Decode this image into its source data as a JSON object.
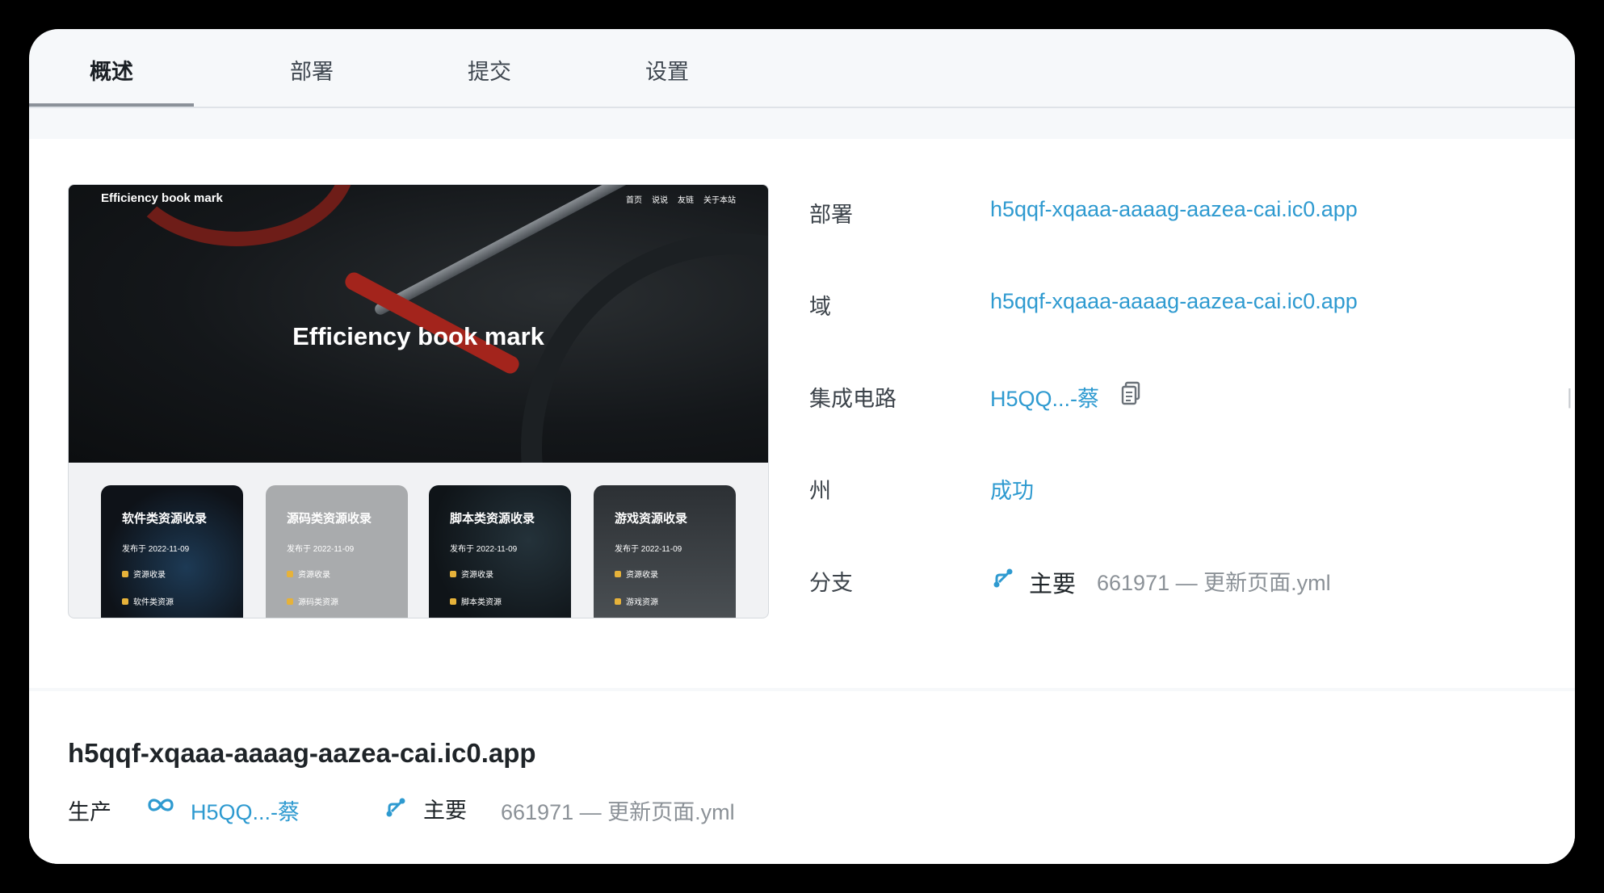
{
  "tabs": [
    {
      "label": "概述"
    },
    {
      "label": "部署"
    },
    {
      "label": "提交"
    },
    {
      "label": "设置"
    }
  ],
  "preview": {
    "brand": "Efficiency book mark",
    "nav": [
      "首页",
      "说说",
      "友链",
      "关于本站"
    ],
    "hero_title": "Efficiency book mark",
    "cards": [
      {
        "title": "软件类资源收录",
        "date": "发布于 2022-11-09",
        "tag1": "资源收录",
        "tag2": "软件类资源"
      },
      {
        "title": "源码类资源收录",
        "date": "发布于 2022-11-09",
        "tag1": "资源收录",
        "tag2": "源码类资源"
      },
      {
        "title": "脚本类资源收录",
        "date": "发布于 2022-11-09",
        "tag1": "资源收录",
        "tag2": "脚本类资源"
      },
      {
        "title": "游戏资源收录",
        "date": "发布于 2022-11-09",
        "tag1": "资源收录",
        "tag2": "游戏资源"
      }
    ]
  },
  "info": {
    "deploy_label": "部署",
    "deploy_value": "h5qqf-xqaaa-aaaag-aazea-cai.ic0.app",
    "domain_label": "域",
    "domain_value": "h5qqf-xqaaa-aaaag-aazea-cai.ic0.app",
    "ic_label": "集成电路",
    "ic_value": "H5QQ...-蔡",
    "state_label": "州",
    "state_value": "成功",
    "branch_label": "分支",
    "branch_name": "主要",
    "branch_commit": "661971 — 更新页面.yml"
  },
  "bottom": {
    "title": "h5qqf-xqaaa-aaaag-aazea-cai.ic0.app",
    "env_label": "生产",
    "link": "H5QQ...-蔡",
    "branch_name": "主要",
    "commit": "661971 — 更新页面.yml"
  },
  "colors": {
    "accent": "#2e9ad0",
    "muted": "#8b9197"
  }
}
